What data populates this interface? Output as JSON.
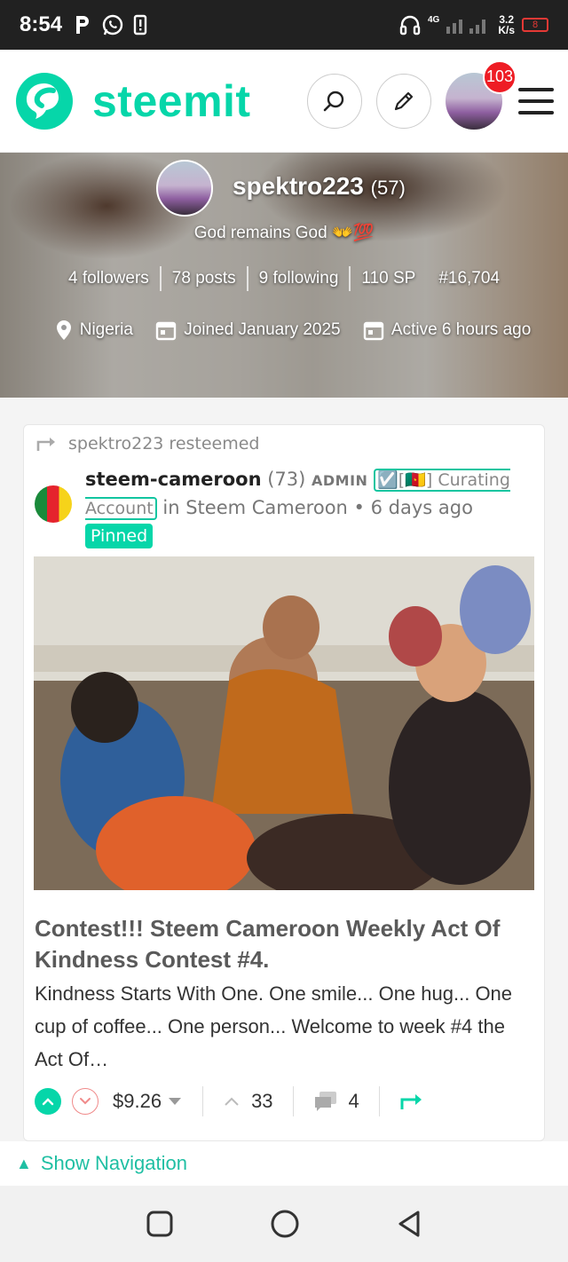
{
  "status_bar": {
    "time": "8:54",
    "network": "4G",
    "speed_value": "3.2",
    "speed_unit": "K/s",
    "battery": "8"
  },
  "header": {
    "logo_text": "steemit",
    "notification_count": "103",
    "brand_color": "#06d6a9"
  },
  "profile": {
    "name": "spektro223",
    "reputation": "(57)",
    "about": "God remains God 👐💯",
    "stats": [
      "4 followers",
      "78 posts",
      "9 following",
      "110 SP",
      "#16,704"
    ],
    "location": "Nigeria",
    "joined": "Joined January 2025",
    "active": "Active 6 hours ago"
  },
  "post": {
    "resteem_text": "spektro223 resteemed",
    "author": "steem-cameroon",
    "author_rep": "(73)",
    "role": "ADMIN",
    "curating_label": "☑️[🇨🇲] Curating Account",
    "community_text": "in Steem Cameroon",
    "time_ago": "6 days ago",
    "pinned_label": "Pinned",
    "title": "Contest!!! Steem Cameroon Weekly Act Of Kindness Contest #4.",
    "excerpt": "Kindness Starts With One. One smile... One hug... One cup of coffee... One person... Welcome to week #4 the Act Of…",
    "payout": "$9.26",
    "votes": "33",
    "comments": "4"
  },
  "footer": {
    "show_navigation": "Show Navigation"
  }
}
